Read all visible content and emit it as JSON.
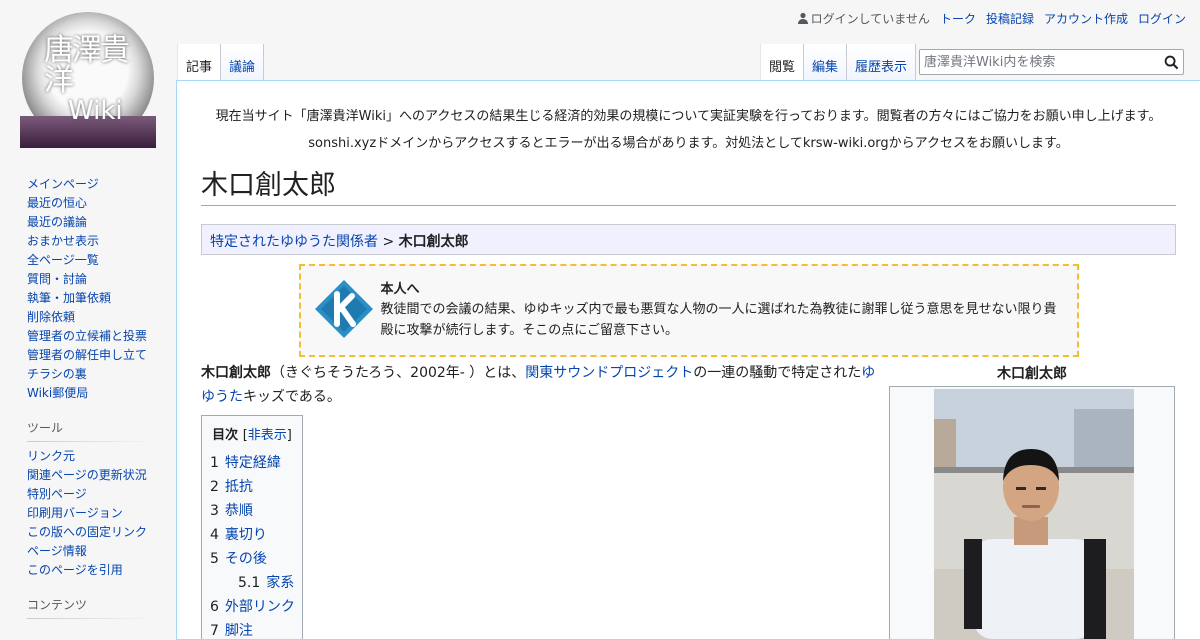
{
  "logo": {
    "line1": "唐澤貴洋",
    "line2": "Wiki"
  },
  "personal": {
    "status": "ログインしていません",
    "links": [
      "トーク",
      "投稿記録",
      "アカウント作成",
      "ログイン"
    ]
  },
  "tabs": {
    "left": [
      "記事",
      "議論"
    ],
    "right": [
      "閲覧",
      "編集",
      "履歴表示"
    ]
  },
  "search": {
    "placeholder": "唐澤貴洋Wiki内を検索"
  },
  "sidebar": {
    "nav": [
      "メインページ",
      "最近の恒心",
      "最近の議論",
      "おまかせ表示",
      "全ページ一覧",
      "質問・討論",
      "執筆・加筆依頼",
      "削除依頼",
      "管理者の立候補と投票",
      "管理者の解任申し立て",
      "チラシの裏",
      "Wiki郵便局"
    ],
    "tools_heading": "ツール",
    "tools": [
      "リンク元",
      "関連ページの更新状況",
      "特別ページ",
      "印刷用バージョン",
      "この版への固定リンク",
      "ページ情報",
      "このページを引用"
    ],
    "contents_heading": "コンテンツ"
  },
  "sitenotice": {
    "line1": "現在当サイト「唐澤貴洋Wiki」へのアクセスの結果生じる経済的効果の規模について実証実験を行っております。閲覧者の方々にはご協力をお願い申し上げます。",
    "line2": "sonshi.xyzドメインからアクセスするとエラーが出る場合があります。対処法としてkrsw-wiki.orgからアクセスをお願いします。"
  },
  "page": {
    "title": "木口創太郎",
    "breadcrumb_link": "特定されたゆゆうた関係者",
    "breadcrumb_sep": " > ",
    "breadcrumb_current": "木口創太郎"
  },
  "notice_box": {
    "title": "本人へ",
    "text": "教徒間での会議の結果、ゆゆキッズ内で最も悪質な人物の一人に選ばれた為教徒に謝罪し従う意思を見せない限り貴殿に攻撃が続行します。そこの点にご留意下さい。"
  },
  "lead": {
    "name": "木口創太郎",
    "part1": "（きぐちそうたろう、2002年- ）とは、",
    "link1": "関東サウンドプロジェクト",
    "part2": "の一連の騒動で特定された",
    "link2": "ゆゆうた",
    "part3": "キッズである。"
  },
  "toc": {
    "title": "目次",
    "toggle_open": "[",
    "toggle_label": "非表示",
    "toggle_close": "]",
    "items": [
      {
        "num": "1",
        "label": "特定経緯"
      },
      {
        "num": "2",
        "label": "抵抗"
      },
      {
        "num": "3",
        "label": "恭順"
      },
      {
        "num": "4",
        "label": "裏切り"
      },
      {
        "num": "5",
        "label": "その後"
      },
      {
        "num": "5.1",
        "label": "家系"
      },
      {
        "num": "6",
        "label": "外部リンク"
      },
      {
        "num": "7",
        "label": "脚注"
      }
    ]
  },
  "infobox": {
    "caption": "木口創太郎"
  },
  "colors": {
    "link": "#0645ad",
    "notice_border": "#f0c030",
    "content_border": "#a7d7f9"
  }
}
